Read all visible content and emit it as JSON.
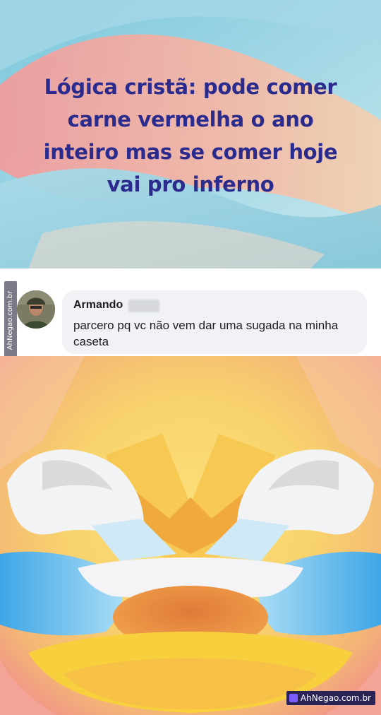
{
  "post": {
    "caption_lines": [
      "Lógica cristã: pode comer",
      "carne vermelha o ano",
      "inteiro mas se comer hoje",
      "vai pro inferno"
    ],
    "text_color": "#2b2b8e"
  },
  "comment": {
    "author": "Armando",
    "text": "parcero pq vc não vem dar uma sugada na minha caseta"
  },
  "watermarks": {
    "side": "AhNegao.com.br",
    "bottom": "AhNegao.com.br"
  },
  "icons": {
    "avatar": "user-avatar-photo",
    "bottom_logo": "ahnegao-logo-icon"
  }
}
